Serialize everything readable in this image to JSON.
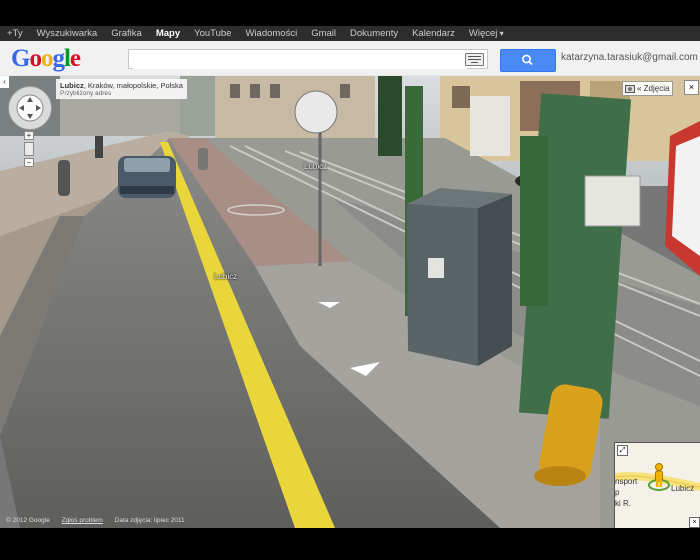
{
  "gbar": {
    "items": [
      {
        "label": "+Ty",
        "active": false
      },
      {
        "label": "Wyszukiwarka",
        "active": false
      },
      {
        "label": "Grafika",
        "active": false
      },
      {
        "label": "Mapy",
        "active": true
      },
      {
        "label": "YouTube",
        "active": false
      },
      {
        "label": "Wiadomości",
        "active": false
      },
      {
        "label": "Gmail",
        "active": false
      },
      {
        "label": "Dokumenty",
        "active": false
      },
      {
        "label": "Kalendarz",
        "active": false
      }
    ],
    "more_label": "Więcej"
  },
  "header": {
    "logo_letters": [
      {
        "ch": "G",
        "color": "#3369e8"
      },
      {
        "ch": "o",
        "color": "#d50f25"
      },
      {
        "ch": "o",
        "color": "#eeb211"
      },
      {
        "ch": "g",
        "color": "#3369e8"
      },
      {
        "ch": "l",
        "color": "#009925"
      },
      {
        "ch": "e",
        "color": "#d50f25"
      }
    ],
    "search_value": "",
    "account_email": "katarzyna.tarasiuk@gmail.com"
  },
  "streetview": {
    "location_name": "Lubicz",
    "location_rest": ", Kraków, małopolskie, Polska",
    "address_note": "Przybliżony adres",
    "photos_label": "« Zdjęcia",
    "close_symbol": "×",
    "street_labels": [
      "Lubicz",
      "Lubicz"
    ],
    "zoom_in": "+",
    "zoom_out": "−"
  },
  "footer": {
    "copyright": "© 2012 Google",
    "report_link": "Zgłoś problem",
    "image_date": "Data zdjęcia: lipiec 2011"
  },
  "minimap": {
    "label_main": "Lubicz",
    "label_2": "nsport",
    "label_3": "p",
    "label_4": "ki R."
  },
  "colors": {
    "search_button": "#4a8af4",
    "gbar_background": "#2d2d2d",
    "road_marking": "#e8d63a"
  }
}
